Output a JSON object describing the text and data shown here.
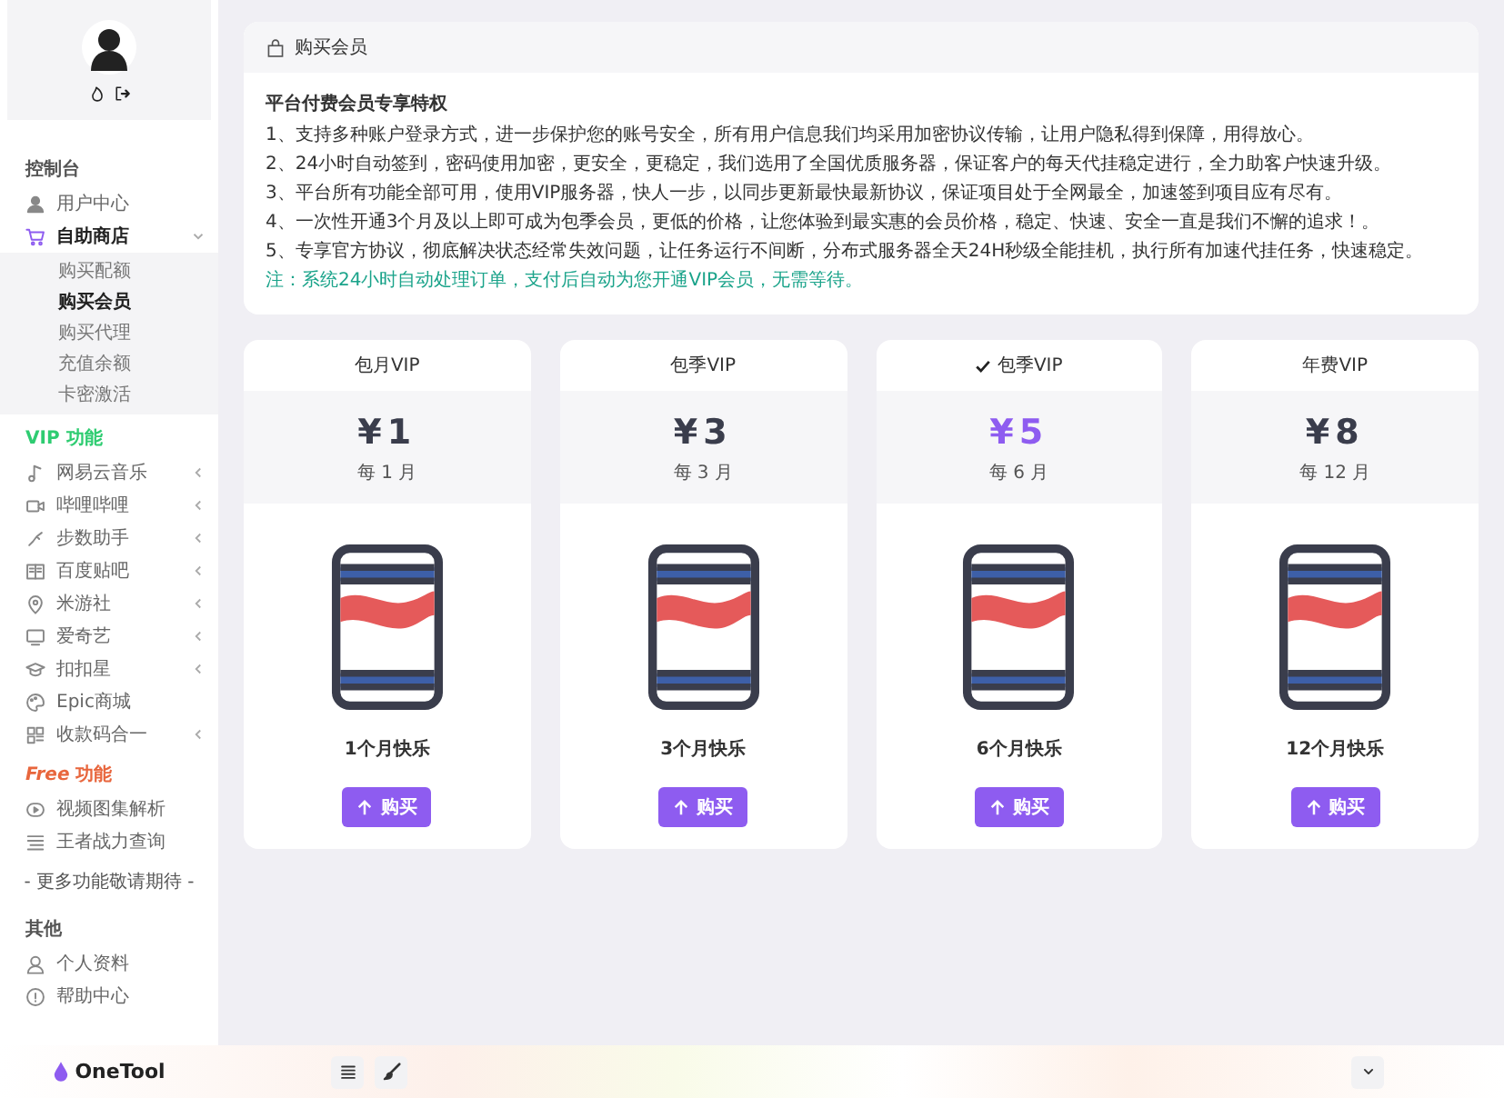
{
  "sidebar": {
    "sections": [
      {
        "title": "控制台",
        "color": "#555555",
        "items": [
          {
            "label": "用户中心",
            "kind": "user",
            "selected": false,
            "arrow": false
          },
          {
            "label": "自助商店",
            "kind": "cart",
            "selected": true,
            "arrow": true,
            "expanded": true,
            "children": [
              {
                "label": "购买配额",
                "selected": false
              },
              {
                "label": "购买会员",
                "selected": true
              },
              {
                "label": "购买代理",
                "selected": false
              },
              {
                "label": "充值余额",
                "selected": false
              },
              {
                "label": "卡密激活",
                "selected": false
              }
            ]
          }
        ]
      },
      {
        "title": "VIP 功能",
        "color": "#2ecc71",
        "items": [
          {
            "label": "网易云音乐",
            "kind": "music",
            "selected": false,
            "arrow": true
          },
          {
            "label": "哔哩哔哩",
            "kind": "video",
            "selected": false,
            "arrow": true
          },
          {
            "label": "步数助手",
            "kind": "steps",
            "selected": false,
            "arrow": true
          },
          {
            "label": "百度贴吧",
            "kind": "book",
            "selected": false,
            "arrow": true
          },
          {
            "label": "米游社",
            "kind": "pin",
            "selected": false,
            "arrow": true
          },
          {
            "label": "爱奇艺",
            "kind": "monitor",
            "selected": false,
            "arrow": true
          },
          {
            "label": "扣扣星",
            "kind": "cap",
            "selected": false,
            "arrow": true
          },
          {
            "label": "Epic商城",
            "kind": "palette",
            "selected": false,
            "arrow": false
          },
          {
            "label": "收款码合一",
            "kind": "grid",
            "selected": false,
            "arrow": true
          }
        ]
      },
      {
        "title": "*Free* 功能",
        "color": "#e8663d",
        "items": [
          {
            "label": "视频图集解析",
            "kind": "play",
            "selected": false,
            "arrow": false
          },
          {
            "label": "王者战力查询",
            "kind": "list",
            "selected": false,
            "arrow": false
          }
        ]
      },
      {
        "note": "- 更多功能敬请期待 -"
      },
      {
        "title": "其他",
        "color": "#555555",
        "items": [
          {
            "label": "个人资料",
            "kind": "person",
            "selected": false,
            "arrow": false
          },
          {
            "label": "帮助中心",
            "kind": "help",
            "selected": false,
            "arrow": false
          }
        ]
      }
    ],
    "brand": "OneTool"
  },
  "info_card": {
    "title": "购买会员",
    "heading": "平台付费会员专享特权",
    "lines": [
      "1、支持多种账户登录方式，进一步保护您的账号安全，所有用户信息我们均采用加密协议传输，让用户隐私得到保障，用得放心。",
      "2、24小时自动签到，密码使用加密，更安全，更稳定，我们选用了全国优质服务器，保证客户的每天代挂稳定进行，全力助客户快速升级。",
      "3、平台所有功能全部可用，使用VIP服务器，快人一步，以同步更新最快最新协议，保证项目处于全网最全，加速签到项目应有尽有。",
      "4、一次性开通3个月及以上即可成为包季会员，更低的价格，让您体验到最实惠的会员价格，稳定、快速、安全一直是我们不懈的追求！。",
      "5、专享官方协议，彻底解决状态经常失效问题，让任务运行不间断，分布式服务器全天24H秒级全能挂机，执行所有加速代挂任务，快速稳定。"
    ],
    "note": "注：系统24小时自动处理订单，支付后自动为您开通VIP会员，无需等待。"
  },
  "plans": [
    {
      "title": "包月VIP",
      "selected": false,
      "price": "¥1",
      "period": "每 1 月",
      "name": "1个月快乐",
      "button": "购买"
    },
    {
      "title": "包季VIP",
      "selected": false,
      "price": "¥3",
      "period": "每 3 月",
      "name": "3个月快乐",
      "button": "购买"
    },
    {
      "title": "包季VIP",
      "selected": true,
      "price": "¥5",
      "period": "每 6 月",
      "name": "6个月快乐",
      "button": "购买"
    },
    {
      "title": "年费VIP",
      "selected": false,
      "price": "¥8",
      "period": "每 12 月",
      "name": "12个月快乐",
      "button": "购买"
    }
  ]
}
